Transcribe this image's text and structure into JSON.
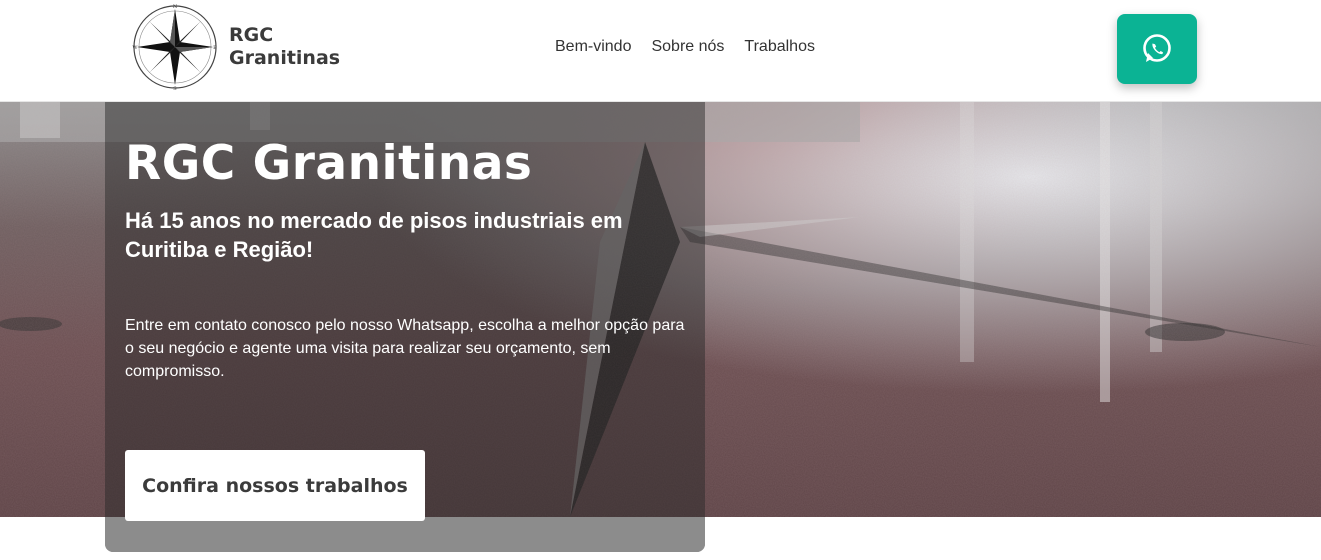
{
  "header": {
    "logo": {
      "line1": "RGC",
      "line2": "Granitinas",
      "compass_letters": {
        "n": "N",
        "s": "S",
        "e": "E",
        "w": "W"
      }
    },
    "nav": [
      "Bem-vindo",
      "Sobre nós",
      "Trabalhos"
    ],
    "whatsapp_button": {
      "icon": "whatsapp-icon",
      "color": "#0bb394"
    }
  },
  "hero": {
    "title": "RGC Granitinas",
    "subtitle": "Há 15 anos no mercado de pisos industriais em Curitiba e Região!",
    "text": "Entre em contato conosco pelo nosso Whatsapp, escolha a melhor opção para o seu negócio e agente uma visita para realizar seu orçamento, sem compromisso.",
    "cta_label": "Confira nossos trabalhos",
    "background": "polished granite floor with compass rose inlay"
  }
}
